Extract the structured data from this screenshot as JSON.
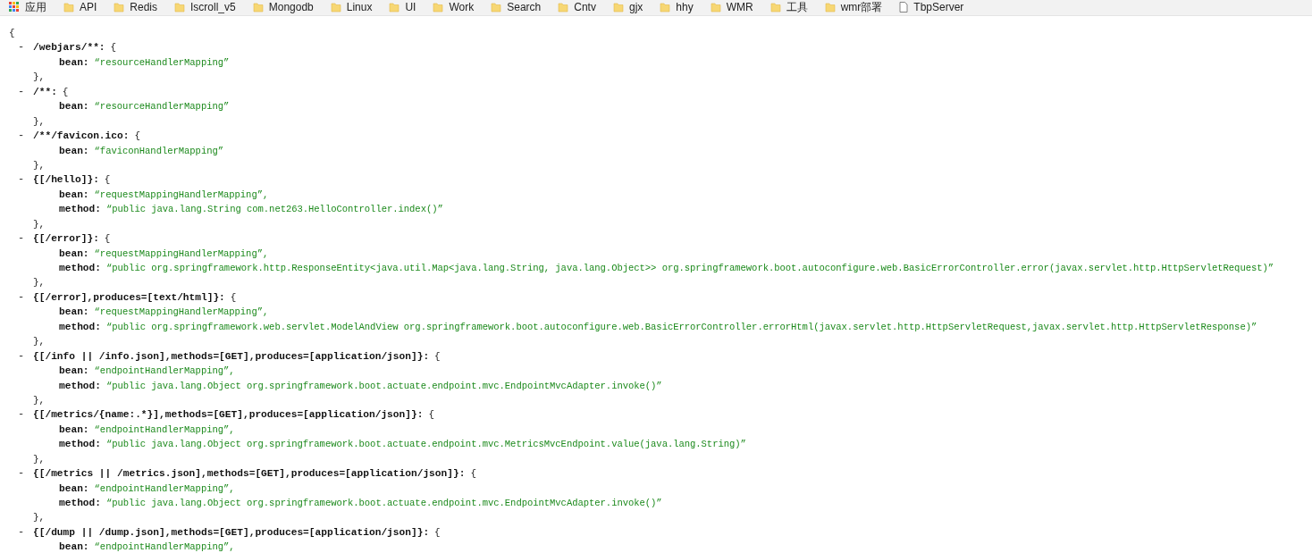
{
  "bookmarks_bar": {
    "items": [
      {
        "kind": "apps",
        "label": "应用"
      },
      {
        "kind": "folder",
        "label": "API"
      },
      {
        "kind": "folder",
        "label": "Redis"
      },
      {
        "kind": "folder",
        "label": "Iscroll_v5"
      },
      {
        "kind": "folder",
        "label": "Mongodb"
      },
      {
        "kind": "folder",
        "label": "Linux"
      },
      {
        "kind": "folder",
        "label": "UI"
      },
      {
        "kind": "folder",
        "label": "Work"
      },
      {
        "kind": "folder",
        "label": "Search"
      },
      {
        "kind": "folder",
        "label": "Cntv"
      },
      {
        "kind": "folder",
        "label": "gjx"
      },
      {
        "kind": "folder",
        "label": "hhy"
      },
      {
        "kind": "folder",
        "label": "WMR"
      },
      {
        "kind": "folder",
        "label": "工具"
      },
      {
        "kind": "folder",
        "label": "wmr部署"
      },
      {
        "kind": "page",
        "label": "TbpServer"
      }
    ]
  },
  "json_view": {
    "open": "{",
    "entries": [
      {
        "toggle": "-",
        "key": "/webjars/**:",
        "brace": "{",
        "fields": [
          {
            "name": "bean:",
            "value": "“resourceHandlerMapping”"
          }
        ],
        "close": "},"
      },
      {
        "toggle": "-",
        "key": "/**:",
        "brace": "{",
        "fields": [
          {
            "name": "bean:",
            "value": "“resourceHandlerMapping”"
          }
        ],
        "close": "},"
      },
      {
        "toggle": "-",
        "key": "/**/favicon.ico:",
        "brace": "{",
        "fields": [
          {
            "name": "bean:",
            "value": "“faviconHandlerMapping”"
          }
        ],
        "close": "},"
      },
      {
        "toggle": "-",
        "key": "{[/hello]}:",
        "brace": "{",
        "fields": [
          {
            "name": "bean:",
            "value": "“requestMappingHandlerMapping”,"
          },
          {
            "name": "method:",
            "value": "“public java.lang.String com.net263.HelloController.index()”"
          }
        ],
        "close": "},"
      },
      {
        "toggle": "-",
        "key": "{[/error]}:",
        "brace": "{",
        "fields": [
          {
            "name": "bean:",
            "value": "“requestMappingHandlerMapping”,"
          },
          {
            "name": "method:",
            "value": "“public org.springframework.http.ResponseEntity<java.util.Map<java.lang.String, java.lang.Object>> org.springframework.boot.autoconfigure.web.BasicErrorController.error(javax.servlet.http.HttpServletRequest)”"
          }
        ],
        "close": "},"
      },
      {
        "toggle": "-",
        "key": "{[/error],produces=[text/html]}:",
        "brace": "{",
        "fields": [
          {
            "name": "bean:",
            "value": "“requestMappingHandlerMapping”,"
          },
          {
            "name": "method:",
            "value": "“public org.springframework.web.servlet.ModelAndView org.springframework.boot.autoconfigure.web.BasicErrorController.errorHtml(javax.servlet.http.HttpServletRequest,javax.servlet.http.HttpServletResponse)”"
          }
        ],
        "close": "},"
      },
      {
        "toggle": "-",
        "key": "{[/info || /info.json],methods=[GET],produces=[application/json]}:",
        "brace": "{",
        "fields": [
          {
            "name": "bean:",
            "value": "“endpointHandlerMapping”,"
          },
          {
            "name": "method:",
            "value": "“public java.lang.Object org.springframework.boot.actuate.endpoint.mvc.EndpointMvcAdapter.invoke()”"
          }
        ],
        "close": "},"
      },
      {
        "toggle": "-",
        "key": "{[/metrics/{name:.*}],methods=[GET],produces=[application/json]}:",
        "brace": "{",
        "fields": [
          {
            "name": "bean:",
            "value": "“endpointHandlerMapping”,"
          },
          {
            "name": "method:",
            "value": "“public java.lang.Object org.springframework.boot.actuate.endpoint.mvc.MetricsMvcEndpoint.value(java.lang.String)”"
          }
        ],
        "close": "},"
      },
      {
        "toggle": "-",
        "key": "{[/metrics || /metrics.json],methods=[GET],produces=[application/json]}:",
        "brace": "{",
        "fields": [
          {
            "name": "bean:",
            "value": "“endpointHandlerMapping”,"
          },
          {
            "name": "method:",
            "value": "“public java.lang.Object org.springframework.boot.actuate.endpoint.mvc.EndpointMvcAdapter.invoke()”"
          }
        ],
        "close": "},"
      },
      {
        "toggle": "-",
        "key": "{[/dump || /dump.json],methods=[GET],produces=[application/json]}:",
        "brace": "{",
        "fields": [
          {
            "name": "bean:",
            "value": "“endpointHandlerMapping”,"
          }
        ]
      }
    ]
  }
}
